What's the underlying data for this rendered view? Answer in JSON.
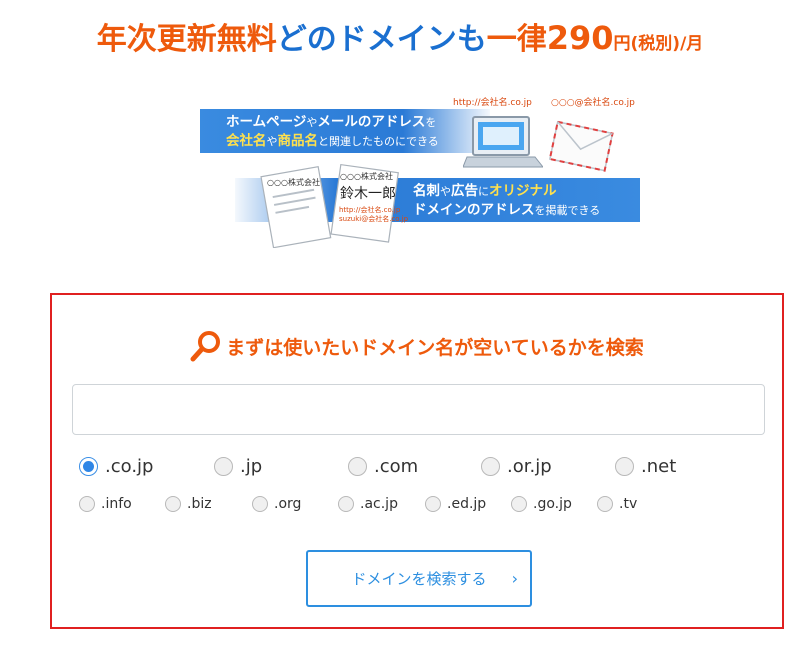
{
  "headline": {
    "part1": "年次更新無料",
    "part2": "どのドメインも",
    "part3": "一律",
    "price": "290",
    "unit": "円",
    "tax": "(税別)",
    "per": "/月"
  },
  "illustration": {
    "band1_line1_a": "ホームページ",
    "band1_line1_b": "や",
    "band1_line1_c": "メールのアドレス",
    "band1_line1_d": "を",
    "band1_line2_a": "会社名",
    "band1_line2_b": "や",
    "band1_line2_c": "商品名",
    "band1_line2_d": "と関連したものにできる",
    "band2_line1_a": "名刺",
    "band2_line1_b": "や",
    "band2_line1_c": "広告",
    "band2_line1_d": "に",
    "band2_line1_e": "オリジナル",
    "band2_line2_a": "ドメインのアドレス",
    "band2_line2_b": "を掲載できる",
    "url_label": "http://会社名.co.jp",
    "email_label": "○○○@会社名.co.jp",
    "card1_company": "○○○株式会社",
    "card2_company": "○○○株式会社",
    "card2_name": "鈴木一郎",
    "card_url": "http://会社名.co.jp",
    "card_email": "suzuki@会社名.co.jp"
  },
  "search": {
    "title": "まずは使いたいドメイン名が空いているかを検索",
    "input_value": "",
    "input_placeholder": "",
    "button_label": "ドメインを検索する",
    "button_chevron": "›",
    "tlds_main": [
      ".co.jp",
      ".jp",
      ".com",
      ".or.jp",
      ".net"
    ],
    "tlds_sub": [
      ".info",
      ".biz",
      ".org",
      ".ac.jp",
      ".ed.jp",
      ".go.jp",
      ".tv"
    ],
    "selected_tld": ".co.jp"
  },
  "colors": {
    "accent_orange": "#ee5a0c",
    "accent_blue": "#1a6fd0",
    "border_red": "#e02020",
    "button_blue": "#2d8fe0"
  }
}
